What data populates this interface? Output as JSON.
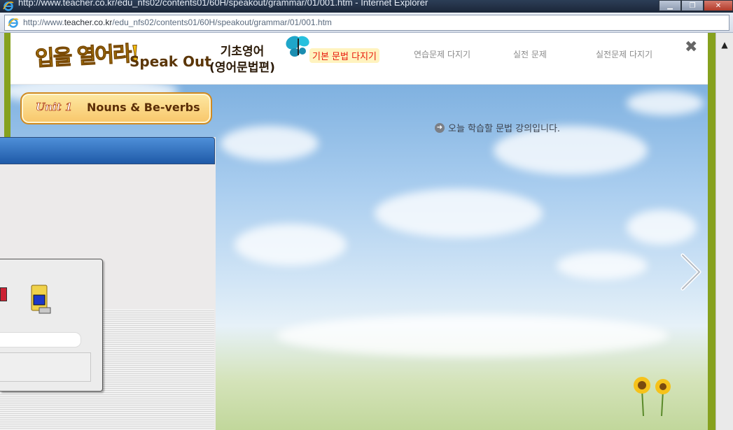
{
  "window": {
    "title": "http://www.teacher.co.kr/edu_nfs02/contents01/60H/speakout/grammar/01/001.htm - Internet Explorer",
    "controls": {
      "minimize": "▁",
      "maximize": "❐",
      "close": "✕"
    }
  },
  "address_bar": {
    "url_prefix": "http://www.",
    "url_domain": "teacher.co.kr",
    "url_path": "/edu_nfs02/contents01/60H/speakout/grammar/01/001.htm"
  },
  "header": {
    "logo_ko": "입을 열어라!",
    "logo_en": "Speak Out",
    "course_line1": "기초영어",
    "course_line2": "(영어문법편)",
    "nav": [
      {
        "label": "기본 문법 다지기",
        "active": true
      },
      {
        "label": "연습문제 다지기",
        "active": false
      },
      {
        "label": "실전 문제",
        "active": false
      },
      {
        "label": "실전문제 다지기",
        "active": false
      }
    ],
    "close_label": "✖"
  },
  "unit": {
    "badge": "Unit 1",
    "title": "Nouns & Be-verbs"
  },
  "main": {
    "lecture_message": "오늘 학습할 문법 강의입니다.",
    "lecture_icon": "arrow-right-circle-icon"
  },
  "colors": {
    "frame_green": "#86a11e",
    "active_nav": "#e8180a",
    "dialog_title_blue": "#1f5aa8"
  }
}
